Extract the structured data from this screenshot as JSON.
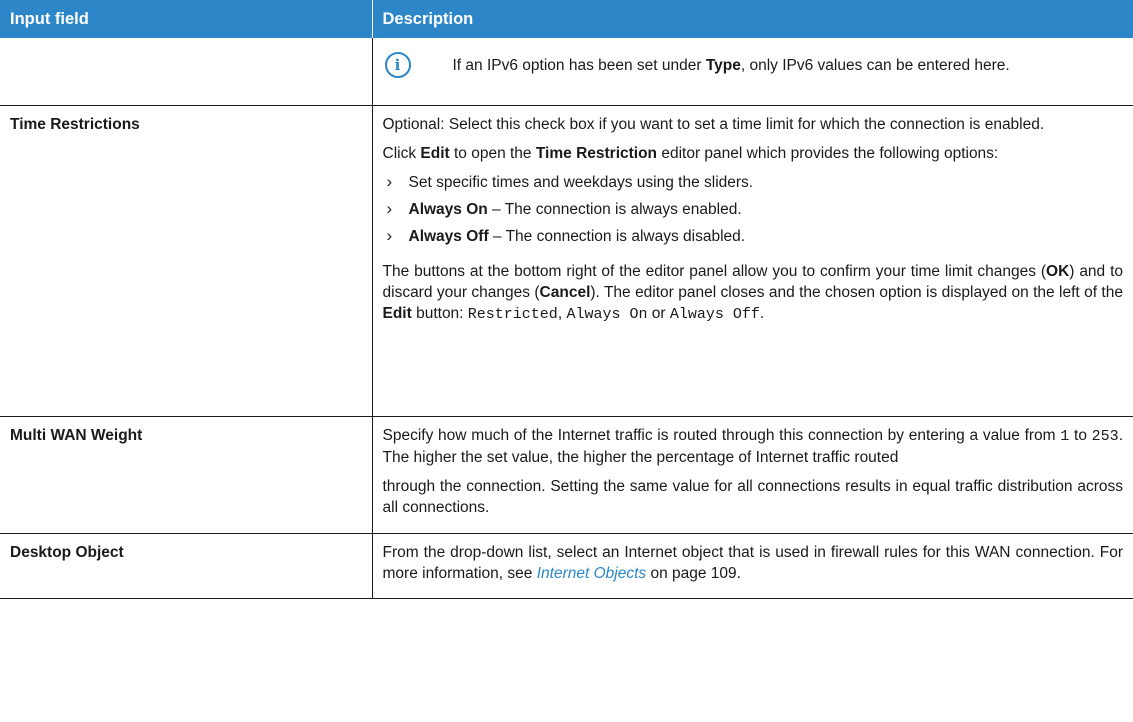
{
  "header": {
    "col1": "Input field",
    "col2": "Description"
  },
  "note_row": {
    "text_before": "If an IPv6 option has been set under ",
    "text_bold": "Type",
    "text_after": ", only IPv6 values can be entered here."
  },
  "time_restrictions": {
    "field": "Time Restrictions",
    "p1": "Optional: Select this check box if you want to set a time limit for which the connection is enabled.",
    "p2_a": "Click ",
    "p2_edit": "Edit",
    "p2_b": " to open the ",
    "p2_tr": "Time Restriction",
    "p2_c": " editor panel which provides the following options:",
    "opt1": "Set specific times and weekdays using the sliders.",
    "opt2_bold": "Always On",
    "opt2_text": " – The connection is always enabled.",
    "opt3_bold": "Always Off",
    "opt3_text": " – The connection is always disabled.",
    "p3_a": "The buttons at the bottom right of the editor panel allow you to confirm your time limit changes (",
    "p3_ok": "OK",
    "p3_b": ") and to discard your changes (",
    "p3_cancel": "Cancel",
    "p3_c": "). The editor panel closes and the chosen option is displayed on the left of the ",
    "p3_edit": "Edit",
    "p3_d": " button: ",
    "mono_restricted": "Restricted",
    "p3_sep1": ", ",
    "mono_on": "Always On",
    "p3_or": " or ",
    "mono_off": "Always Off",
    "p3_end": "."
  },
  "multi_wan": {
    "field": "Multi WAN Weight",
    "p1_a": "Specify how much of the Internet traffic is routed through this connection by entering a value from ",
    "mono_min": "1",
    "p1_to": " to ",
    "mono_max": "253",
    "p1_b": ". The higher the set value, the higher the percentage of Internet traffic routed",
    "p2": "through the connection. Setting the same value for all connections results in equal traffic distribution across all connections."
  },
  "desktop_object": {
    "field": "Desktop Object",
    "p1_a": "From the drop-down list, select an Internet object that is used in firewall rules for this WAN connection. For more information, see ",
    "link": "Internet Objects",
    "p1_b": " on page 109."
  },
  "colors": {
    "header_bg": "#2c86c8",
    "link": "#2c86c8",
    "icon": "#2c86c8"
  },
  "icons": {
    "note": "info-icon",
    "bullet": "chevron-right-icon"
  }
}
